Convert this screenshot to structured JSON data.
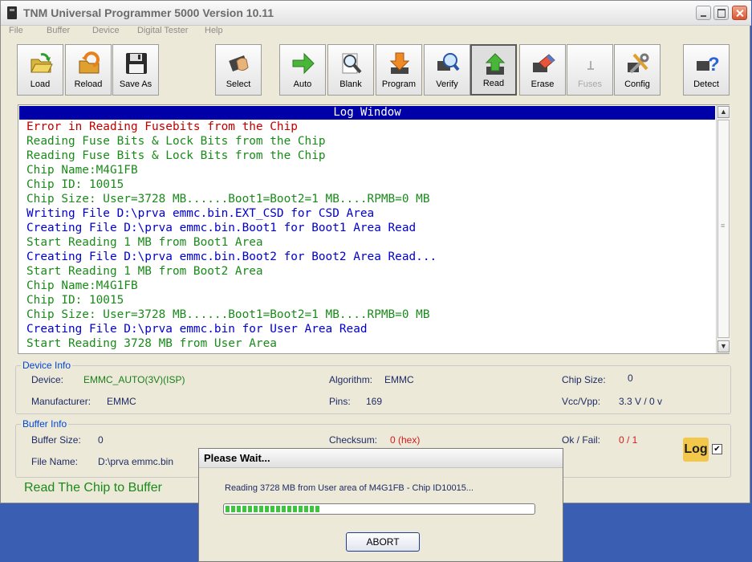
{
  "window": {
    "title": "TNM  Universal Programmer 5000   Version 10.11"
  },
  "menu": [
    "File",
    "Buffer",
    "Device",
    "Digital Tester",
    "Help"
  ],
  "toolbar": [
    {
      "label": "Load",
      "icon": "folder-open-icon"
    },
    {
      "label": "Reload",
      "icon": "reload-icon"
    },
    {
      "label": "Save As",
      "icon": "floppy-disk-icon"
    },
    {
      "label": "Select",
      "icon": "chip-select-icon"
    },
    {
      "label": "Auto",
      "icon": "green-arrow-icon"
    },
    {
      "label": "Blank",
      "icon": "magnifier-icon"
    },
    {
      "label": "Program",
      "icon": "download-arrow-icon"
    },
    {
      "label": "Verify",
      "icon": "verify-magnifier-icon"
    },
    {
      "label": "Read",
      "icon": "upload-arrow-icon",
      "pressed": true
    },
    {
      "label": "Erase",
      "icon": "eraser-icon"
    },
    {
      "label": "Fuses",
      "icon": "fuses-icon",
      "disabled": true
    },
    {
      "label": "Config",
      "icon": "tools-icon"
    },
    {
      "label": "Detect",
      "icon": "chip-question-icon"
    }
  ],
  "log": {
    "header": "Log Window",
    "lines": [
      {
        "text": "Error in Reading Fusebits from the Chip",
        "color": "#c00000"
      },
      {
        "text": "Reading Fuse Bits & Lock Bits from the Chip",
        "color": "#1a8a1a"
      },
      {
        "text": "Reading Fuse Bits & Lock Bits from the Chip",
        "color": "#1a8a1a"
      },
      {
        "text": "Chip Name:M4G1FB",
        "color": "#1a8a1a"
      },
      {
        "text": "Chip ID: 10015",
        "color": "#1a8a1a"
      },
      {
        "text": "Chip Size: User=3728 MB......Boot1=Boot2=1 MB....RPMB=0 MB",
        "color": "#1a8a1a"
      },
      {
        "text": "Writing File D:\\prva emmc.bin.EXT_CSD for CSD Area",
        "color": "#0000cc"
      },
      {
        "text": "Creating File D:\\prva emmc.bin.Boot1 for Boot1 Area Read",
        "color": "#0000cc"
      },
      {
        "text": "Start Reading 1 MB from Boot1 Area",
        "color": "#1a8a1a"
      },
      {
        "text": "Creating File D:\\prva emmc.bin.Boot2 for Boot2 Area Read...",
        "color": "#0000cc"
      },
      {
        "text": "Start Reading 1 MB from Boot2 Area",
        "color": "#1a8a1a"
      },
      {
        "text": "Chip Name:M4G1FB",
        "color": "#1a8a1a"
      },
      {
        "text": "Chip ID: 10015",
        "color": "#1a8a1a"
      },
      {
        "text": "Chip Size: User=3728 MB......Boot1=Boot2=1 MB....RPMB=0 MB",
        "color": "#1a8a1a"
      },
      {
        "text": "Creating File D:\\prva emmc.bin for User Area Read",
        "color": "#0000cc"
      },
      {
        "text": "Start Reading 3728 MB from User Area",
        "color": "#1a8a1a"
      }
    ]
  },
  "device_info": {
    "legend": "Device Info",
    "device_label": "Device:",
    "device": "EMMC_AUTO(3V)(ISP)",
    "algorithm_label": "Algorithm:",
    "algorithm": "EMMC",
    "chip_size_label": "Chip Size:",
    "chip_size": "0",
    "manufacturer_label": "Manufacturer:",
    "manufacturer": "EMMC",
    "pins_label": "Pins:",
    "pins": "169",
    "vcc_label": "Vcc/Vpp:",
    "vcc": "3.3 V / 0 v"
  },
  "buffer_info": {
    "legend": "Buffer Info",
    "size_label": "Buffer Size:",
    "size": "0",
    "checksum_label": "Checksum:",
    "checksum": "0 (hex)",
    "okfail_label": "Ok / Fail:",
    "okfail": "0 / 1",
    "file_label": "File Name:",
    "file": "D:\\prva emmc.bin",
    "log_badge": "Log",
    "log_checked": true
  },
  "status": "Read The Chip to Buffer",
  "dialog": {
    "title": "Please Wait...",
    "message": "Reading  3728 MB from User area of M4G1FB - Chip ID10015...",
    "progress": 0.31,
    "abort_label": "ABORT"
  }
}
